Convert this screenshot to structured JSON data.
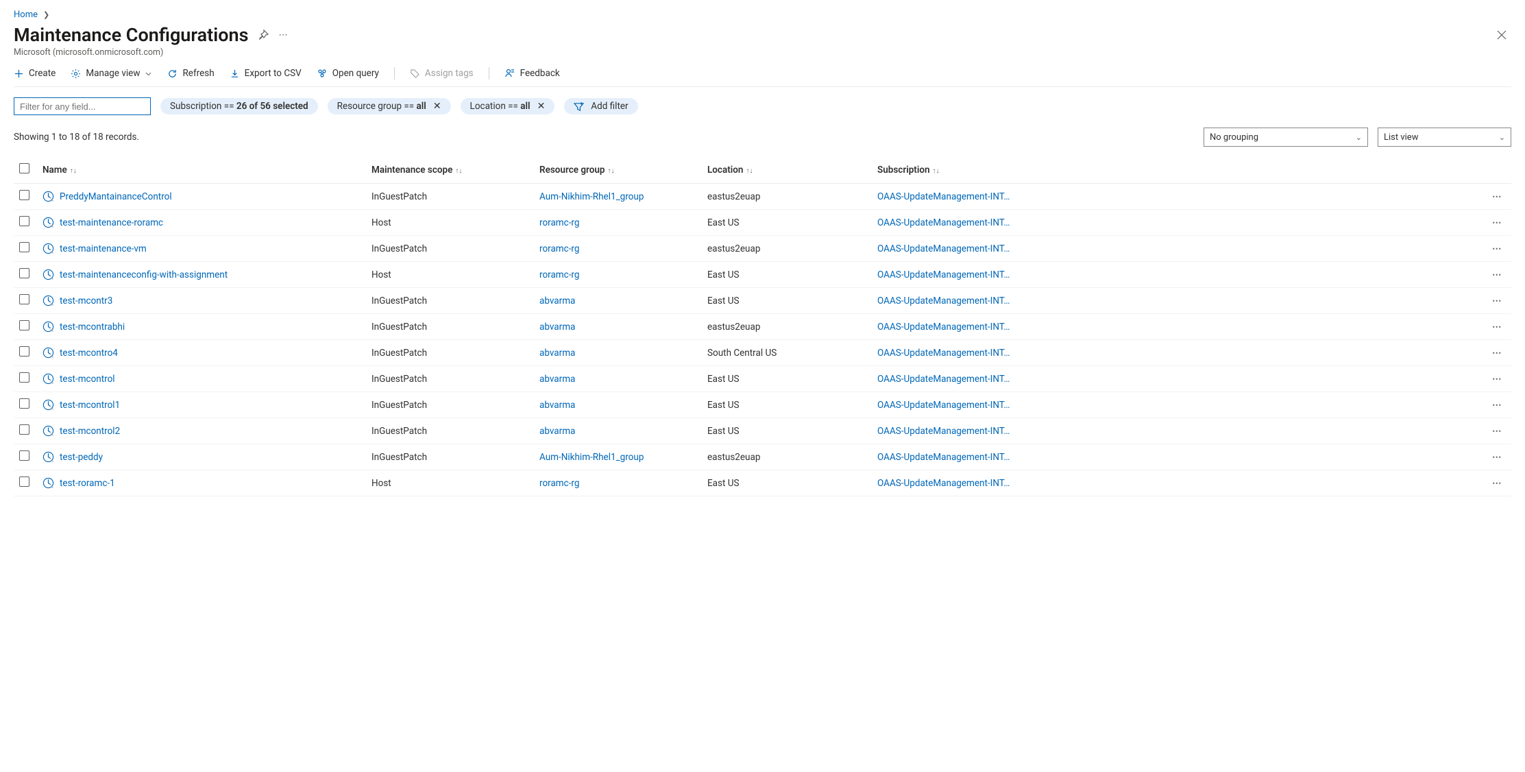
{
  "breadcrumb": {
    "home": "Home"
  },
  "header": {
    "title": "Maintenance Configurations",
    "subtitle": "Microsoft (microsoft.onmicrosoft.com)"
  },
  "commandbar": {
    "create": "Create",
    "manage_view": "Manage view",
    "refresh": "Refresh",
    "export_csv": "Export to CSV",
    "open_query": "Open query",
    "assign_tags": "Assign tags",
    "feedback": "Feedback"
  },
  "filters": {
    "placeholder": "Filter for any field...",
    "subscription_prefix": "Subscription == ",
    "subscription_value": "26 of 56 selected",
    "rg_prefix": "Resource group == ",
    "rg_value": "all",
    "location_prefix": "Location == ",
    "location_value": "all",
    "add_filter": "Add filter"
  },
  "status": {
    "showing": "Showing 1 to 18 of 18 records.",
    "grouping": "No grouping",
    "view": "List view"
  },
  "columns": {
    "name": "Name",
    "scope": "Maintenance scope",
    "rg": "Resource group",
    "location": "Location",
    "subscription": "Subscription"
  },
  "rows": [
    {
      "name": "PreddyMantainanceControl",
      "scope": "InGuestPatch",
      "rg": "Aum-Nikhim-Rhel1_group",
      "location": "eastus2euap",
      "sub": "OAAS-UpdateManagement-INT…"
    },
    {
      "name": "test-maintenance-roramc",
      "scope": "Host",
      "rg": "roramc-rg",
      "location": "East US",
      "sub": "OAAS-UpdateManagement-INT…"
    },
    {
      "name": "test-maintenance-vm",
      "scope": "InGuestPatch",
      "rg": "roramc-rg",
      "location": "eastus2euap",
      "sub": "OAAS-UpdateManagement-INT…"
    },
    {
      "name": "test-maintenanceconfig-with-assignment",
      "scope": "Host",
      "rg": "roramc-rg",
      "location": "East US",
      "sub": "OAAS-UpdateManagement-INT…"
    },
    {
      "name": "test-mcontr3",
      "scope": "InGuestPatch",
      "rg": "abvarma",
      "location": "East US",
      "sub": "OAAS-UpdateManagement-INT…"
    },
    {
      "name": "test-mcontrabhi",
      "scope": "InGuestPatch",
      "rg": "abvarma",
      "location": "eastus2euap",
      "sub": "OAAS-UpdateManagement-INT…"
    },
    {
      "name": "test-mcontro4",
      "scope": "InGuestPatch",
      "rg": "abvarma",
      "location": "South Central US",
      "sub": "OAAS-UpdateManagement-INT…"
    },
    {
      "name": "test-mcontrol",
      "scope": "InGuestPatch",
      "rg": "abvarma",
      "location": "East US",
      "sub": "OAAS-UpdateManagement-INT…"
    },
    {
      "name": "test-mcontrol1",
      "scope": "InGuestPatch",
      "rg": "abvarma",
      "location": "East US",
      "sub": "OAAS-UpdateManagement-INT…"
    },
    {
      "name": "test-mcontrol2",
      "scope": "InGuestPatch",
      "rg": "abvarma",
      "location": "East US",
      "sub": "OAAS-UpdateManagement-INT…"
    },
    {
      "name": "test-peddy",
      "scope": "InGuestPatch",
      "rg": "Aum-Nikhim-Rhel1_group",
      "location": "eastus2euap",
      "sub": "OAAS-UpdateManagement-INT…"
    },
    {
      "name": "test-roramc-1",
      "scope": "Host",
      "rg": "roramc-rg",
      "location": "East US",
      "sub": "OAAS-UpdateManagement-INT…"
    }
  ]
}
